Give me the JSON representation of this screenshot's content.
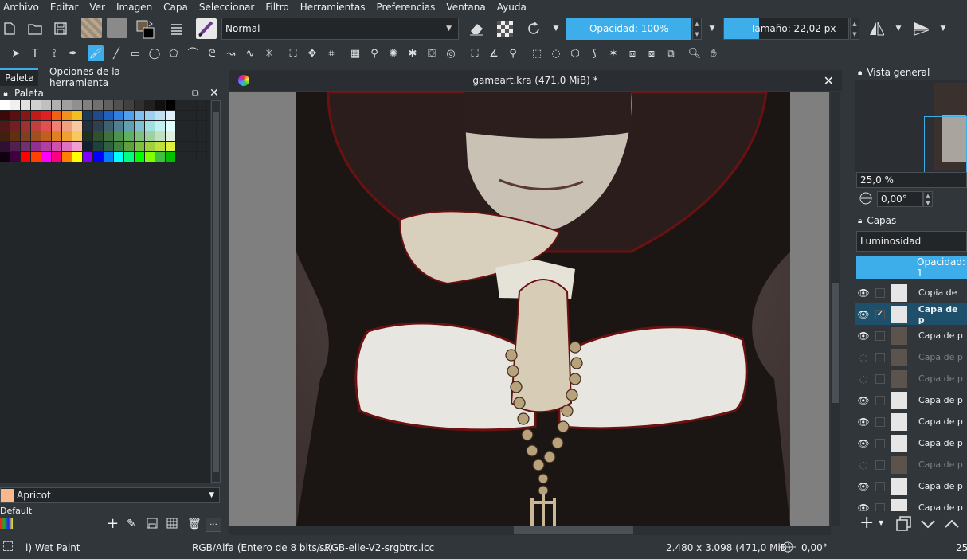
{
  "menu": [
    "Archivo",
    "Editar",
    "Ver",
    "Imagen",
    "Capa",
    "Seleccionar",
    "Filtro",
    "Herramientas",
    "Preferencias",
    "Ventana",
    "Ayuda"
  ],
  "toolbar": {
    "blend_mode": "Normal",
    "opacity_label": "Opacidad: 100%",
    "size_label": "Tamaño: 22,02 px",
    "icons": [
      "new-document-icon",
      "open-icon",
      "save-icon",
      "gradient-swatch-icon",
      "pattern-swatch-icon",
      "color-swatches-icon",
      "stack-icon",
      "brush-preset-icon",
      "eraser-icon",
      "alpha-lock-icon",
      "reload-icon",
      "mirror-horizontal-icon",
      "mirror-vertical-icon"
    ]
  },
  "tools": [
    "select-shape-icon",
    "text-icon",
    "edit-shapes-icon",
    "calligraphy-icon",
    "brush-icon",
    "line-icon",
    "rectangle-icon",
    "ellipse-icon",
    "polygon-icon",
    "polyline-icon",
    "bezier-icon",
    "freehand-path-icon",
    "dynamic-brush-icon",
    "multibrush-icon",
    "transform-icon",
    "move-icon",
    "crop-icon",
    "gradient-icon",
    "color-picker-icon",
    "colorize-mask-icon",
    "smart-patch-icon",
    "fill-icon",
    "enclose-fill-icon",
    "assistant-icon",
    "measure-icon",
    "reference-icon",
    "rect-select-icon",
    "ellipse-select-icon",
    "polygon-select-icon",
    "freehand-select-icon",
    "contiguous-select-icon",
    "similar-select-icon",
    "bezier-select-icon",
    "magnetic-select-icon",
    "zoom-icon",
    "pan-icon"
  ],
  "left_docker": {
    "tabs": [
      "Paleta",
      "Opciones de la herramienta"
    ],
    "palette_title": "Paleta",
    "selected_color_name": "Apricot",
    "selected_color": "#f8b88b",
    "palette_name": "Default",
    "palette_rows": [
      [
        "#ffffff",
        "#f0f0f0",
        "#e0e0e0",
        "#d0d0d0",
        "#c0c0c0",
        "#b0b0b0",
        "#a0a0a0",
        "#909090",
        "#808080",
        "#707070",
        "#606060",
        "#505050",
        "#404040",
        "#303030",
        "#202020",
        "#101010",
        "#000000"
      ],
      [
        "#3a0a0a",
        "#5a1010",
        "#8a1515",
        "#c01a1a",
        "#e02020",
        "#f06010",
        "#f09020",
        "#f0c020",
        "#1a3a5a",
        "#204a8a",
        "#2060c0",
        "#3080e0",
        "#50a0f0",
        "#80c0f0",
        "#a0d0f0",
        "#c0e0f0",
        "#e0f0f8"
      ],
      [
        "#501818",
        "#702020",
        "#a03030",
        "#c04040",
        "#e05050",
        "#f08070",
        "#f0a080",
        "#f8c8a0",
        "#203040",
        "#304050",
        "#406070",
        "#508090",
        "#60a0b0",
        "#80c0d0",
        "#a0e0e0",
        "#c0f0f0",
        "#e0ffff"
      ],
      [
        "#402010",
        "#603010",
        "#804020",
        "#a05020",
        "#c06020",
        "#e08020",
        "#f0a030",
        "#f8c860",
        "#203020",
        "#305030",
        "#407040",
        "#509050",
        "#60b060",
        "#80c080",
        "#a0d0a0",
        "#c0e0c0",
        "#e0f0e0"
      ],
      [
        "#301030",
        "#502050",
        "#703070",
        "#903090",
        "#b040a0",
        "#d050b0",
        "#e070c0",
        "#f0a0d0",
        "#102030",
        "#204040",
        "#306040",
        "#408040",
        "#60a040",
        "#80c040",
        "#a0d040",
        "#c0e040",
        "#e0f040"
      ],
      [
        "#100010",
        "#400040",
        "#ff0000",
        "#ff4000",
        "#ff00ff",
        "#ff0080",
        "#ff8000",
        "#ffff00",
        "#8000ff",
        "#0000ff",
        "#0080ff",
        "#00ffff",
        "#00ff80",
        "#00ff00",
        "#80ff00",
        "#40c040",
        "#00c000"
      ]
    ]
  },
  "canvas": {
    "title": "gameart.kra (471,0 MiB) *"
  },
  "right_docker": {
    "overview_title": "Vista general",
    "zoom": "25,0 %",
    "rotation": "0,00°",
    "layers_title": "Capas",
    "blend_mode": "Luminosidad",
    "opacity_label": "Opacidad: 1",
    "layers": [
      {
        "name": "Copia de",
        "visible": true,
        "active": false,
        "dim": false
      },
      {
        "name": "Capa de p",
        "visible": true,
        "active": true,
        "dim": false
      },
      {
        "name": "Capa de p",
        "visible": true,
        "active": false,
        "dim": false
      },
      {
        "name": "Capa de p",
        "visible": false,
        "active": false,
        "dim": true
      },
      {
        "name": "Capa de p",
        "visible": false,
        "active": false,
        "dim": true
      },
      {
        "name": "Capa de p",
        "visible": true,
        "active": false,
        "dim": false
      },
      {
        "name": "Capa de p",
        "visible": true,
        "active": false,
        "dim": false
      },
      {
        "name": "Capa de p",
        "visible": true,
        "active": false,
        "dim": false
      },
      {
        "name": "Capa de p",
        "visible": false,
        "active": false,
        "dim": true
      },
      {
        "name": "Capa de p",
        "visible": true,
        "active": false,
        "dim": false
      },
      {
        "name": "Capa de p",
        "visible": true,
        "active": false,
        "dim": false
      }
    ]
  },
  "status": {
    "brush": "i) Wet Paint",
    "color_model": "RGB/Alfa (Entero de 8 bits/...)",
    "profile": "sRGB-elle-V2-srgbtrc.icc",
    "dimensions": "2.480 x 3.098 (471,0 MiB)",
    "rotation": "0,00°",
    "zoom": "25"
  }
}
